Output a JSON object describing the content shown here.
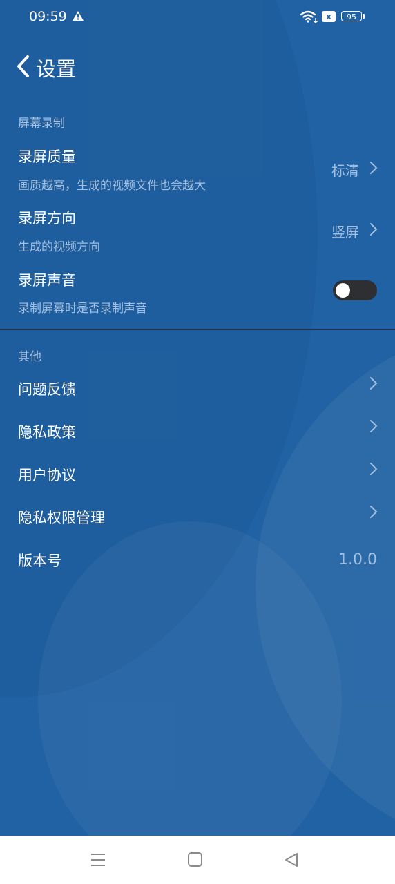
{
  "status_bar": {
    "time": "09:59",
    "battery": "95",
    "sim_icon_text": "x",
    "icons": [
      "warning-icon",
      "wifi-icon",
      "sim-blocked-icon",
      "battery-icon"
    ]
  },
  "header": {
    "title": "设置",
    "back_icon": "chevron-left-icon"
  },
  "sections": {
    "recording": {
      "label": "屏幕录制",
      "quality": {
        "title": "录屏质量",
        "subtitle": "画质越高，生成的视频文件也会越大",
        "value": "标清"
      },
      "orientation": {
        "title": "录屏方向",
        "subtitle": "生成的视频方向",
        "value": "竖屏"
      },
      "audio": {
        "title": "录屏声音",
        "subtitle": "录制屏幕时是否录制声音",
        "enabled": false
      }
    },
    "other": {
      "label": "其他",
      "feedback": {
        "title": "问题反馈"
      },
      "privacy_policy": {
        "title": "隐私政策"
      },
      "user_agreement": {
        "title": "用户协议"
      },
      "permissions": {
        "title": "隐私权限管理"
      },
      "version": {
        "title": "版本号",
        "value": "1.0.0"
      }
    }
  },
  "nav_bar": {
    "icons": [
      "menu-icon",
      "home-icon",
      "back-triangle-icon"
    ]
  },
  "colors": {
    "background": "#2162a4",
    "subtext": "#a3bfdf",
    "toggle_off": "#2d2f33"
  }
}
